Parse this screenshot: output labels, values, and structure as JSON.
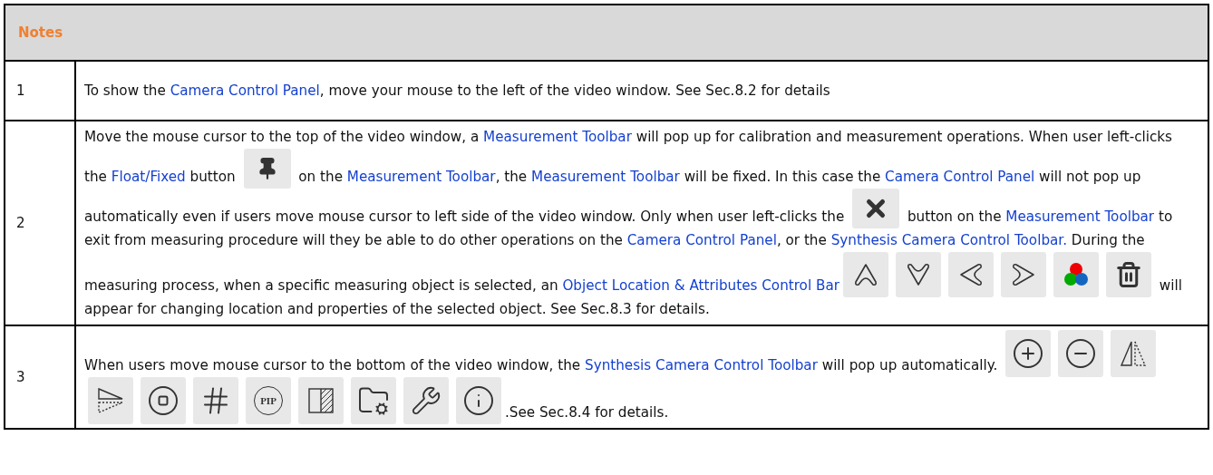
{
  "table": {
    "header": "Notes",
    "rows": [
      {
        "number": "1",
        "segments": [
          {
            "kind": "text",
            "text": "To show the "
          },
          {
            "kind": "link",
            "text": "Camera Control Panel"
          },
          {
            "kind": "text",
            "text": ", move your mouse to the left of the video window. See Sec.8.2 for details"
          }
        ]
      },
      {
        "number": "2",
        "segments": [
          {
            "kind": "text",
            "text": "Move the mouse cursor to the top of the video window, a "
          },
          {
            "kind": "link",
            "text": "Measurement Toolbar"
          },
          {
            "kind": "text",
            "text": " will pop up for calibration and measurement operations. When user left-clicks the "
          },
          {
            "kind": "link",
            "text": "Float/Fixed"
          },
          {
            "kind": "text",
            "text": " button "
          },
          {
            "kind": "icon"
          },
          {
            "kind": "text",
            "text": " on the "
          },
          {
            "kind": "link",
            "text": "Measurement Toolbar"
          },
          {
            "kind": "text",
            "text": ", the "
          },
          {
            "kind": "link",
            "text": "Measurement Toolbar"
          },
          {
            "kind": "text",
            "text": " will be fixed. In this case the "
          },
          {
            "kind": "link",
            "text": "Camera Control Panel"
          },
          {
            "kind": "text",
            "text": " will not pop up automatically even if users move mouse cursor to left side of the video window. Only when user left-clicks the "
          },
          {
            "kind": "icon"
          },
          {
            "kind": "text",
            "text": " button on the "
          },
          {
            "kind": "link",
            "text": "Measurement Toolbar"
          },
          {
            "kind": "text",
            "text": " to exit from measuring procedure will they be able to do other operations on the "
          },
          {
            "kind": "link",
            "text": "Camera Control Panel"
          },
          {
            "kind": "text",
            "text": ", or the "
          },
          {
            "kind": "link",
            "text": "Synthesis Camera Control Toolbar."
          },
          {
            "kind": "text",
            "text": " During the measuring process, when a specific measuring object is selected, an "
          },
          {
            "kind": "link",
            "text": "Object Location & Attributes Control Bar"
          },
          {
            "kind": "icon"
          },
          {
            "kind": "icon"
          },
          {
            "kind": "icon"
          },
          {
            "kind": "icon"
          },
          {
            "kind": "icon"
          },
          {
            "kind": "icon"
          },
          {
            "kind": "text",
            "text": " will appear for changing location and properties of the selected object. See Sec.8.3 for details."
          }
        ]
      },
      {
        "number": "3",
        "segments": [
          {
            "kind": "text",
            "text": "When users move mouse cursor to the bottom of the video window, the "
          },
          {
            "kind": "link",
            "text": "Synthesis Camera Control Toolbar"
          },
          {
            "kind": "text",
            "text": " will pop up automatically. "
          },
          {
            "kind": "icon"
          },
          {
            "kind": "icon"
          },
          {
            "kind": "icon"
          },
          {
            "kind": "icon"
          },
          {
            "kind": "icon"
          },
          {
            "kind": "icon"
          },
          {
            "kind": "icon",
            "text": "PIP"
          },
          {
            "kind": "icon"
          },
          {
            "kind": "icon"
          },
          {
            "kind": "icon"
          },
          {
            "kind": "icon"
          },
          {
            "kind": "text",
            "text": ".See Sec.8.4 for details."
          }
        ]
      }
    ]
  }
}
